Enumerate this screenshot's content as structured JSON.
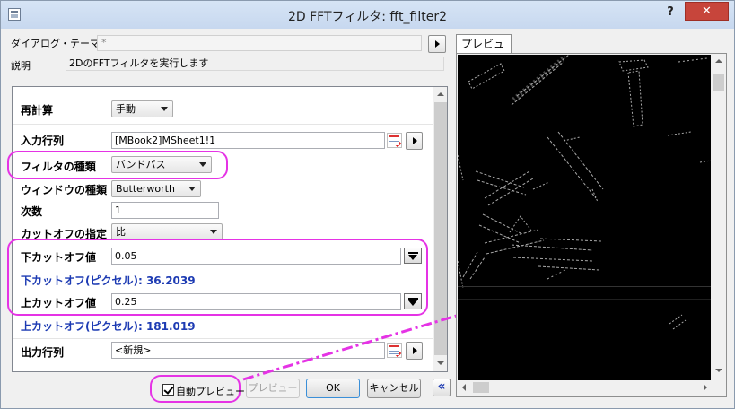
{
  "window": {
    "title": "2D FFTフィルタ: fft_filter2",
    "help_label": "?",
    "close_label": "✕"
  },
  "dialog_theme": {
    "label": "ダイアログ・テーマ(H)",
    "value": "*"
  },
  "description": {
    "label": "説明",
    "text": "2DのFFTフィルタを実行します"
  },
  "params": {
    "recalc": {
      "label": "再計算",
      "value": "手動"
    },
    "input": {
      "label": "入力行列",
      "value": "[MBook2]MSheet1!1"
    },
    "filter_type": {
      "label": "フィルタの種類",
      "value": "バンドパス"
    },
    "window_type": {
      "label": "ウィンドウの種類",
      "value": "Butterworth"
    },
    "order": {
      "label": "次数",
      "value": "1"
    },
    "cutoff_spec": {
      "label": "カットオフの指定",
      "value": "比"
    },
    "lower_cutoff": {
      "label": "下カットオフ値",
      "value": "0.05"
    },
    "lower_cutoff_px": {
      "label": "下カットオフ(ピクセル): 36.2039"
    },
    "upper_cutoff": {
      "label": "上カットオフ値",
      "value": "0.25"
    },
    "upper_cutoff_px": {
      "label": "上カットオフ(ピクセル): 181.019"
    },
    "output": {
      "label": "出力行列",
      "value": "<新規>"
    }
  },
  "footer": {
    "auto_preview_label": "自動プレビュー",
    "auto_preview_checked": true,
    "preview_button": "プレビュー",
    "ok_button": "OK",
    "cancel_button": "キャンセル",
    "collapse_button": "«"
  },
  "preview": {
    "tab_label": "プレビュー"
  },
  "colors": {
    "highlight": "#e533e5",
    "blue_text": "#1d3bb3"
  }
}
